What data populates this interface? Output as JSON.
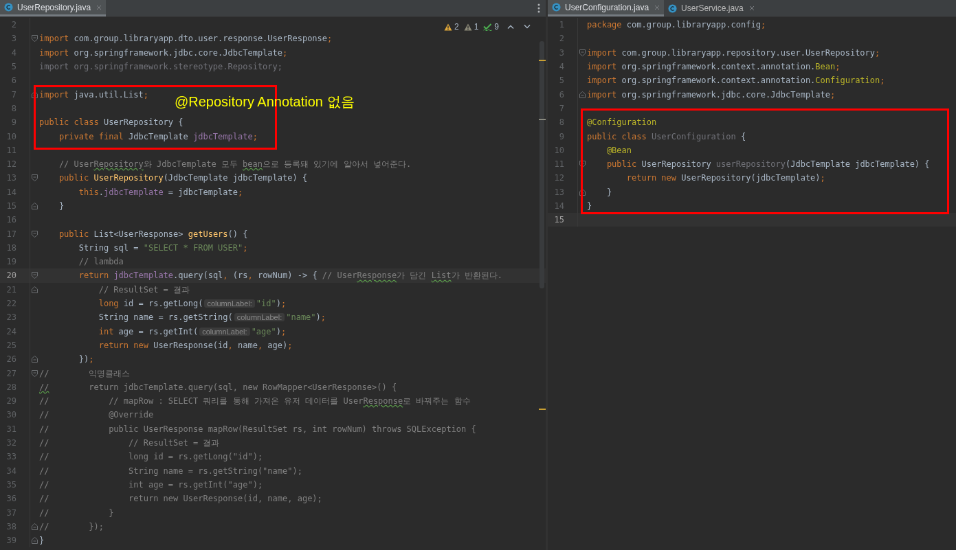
{
  "panes": [
    {
      "tabs": [
        {
          "label": "UserRepository.java",
          "selected": true
        }
      ],
      "inspections": [
        {
          "kind": "warning",
          "count": "2"
        },
        {
          "kind": "weak",
          "count": "1"
        },
        {
          "kind": "typo",
          "count": "9"
        }
      ],
      "note": "@Repository Annotation 없음",
      "lines": [
        {
          "number": "2"
        },
        {
          "number": "3",
          "fold_start": true,
          "tokens": [
            {
              "text": "import",
              "kind": "k"
            },
            {
              "text": " com.group.libraryapp.dto.user.response.UserResponse",
              "kind": "p"
            },
            {
              "text": ";",
              "kind": "k"
            }
          ]
        },
        {
          "number": "4",
          "tokens": [
            {
              "text": "import",
              "kind": "k"
            },
            {
              "text": " org.springframework.jdbc.core.JdbcTemplate",
              "kind": "p"
            },
            {
              "text": ";",
              "kind": "k"
            }
          ]
        },
        {
          "number": "5",
          "tokens": [
            {
              "text": "import org.springframework.stereotype.Repository;",
              "kind": "u"
            }
          ]
        },
        {
          "number": "6"
        },
        {
          "number": "7",
          "fold_end": true,
          "boxed": true,
          "tokens": [
            {
              "text": "import",
              "kind": "k"
            },
            {
              "text": " java.util.List",
              "kind": "p"
            },
            {
              "text": ";",
              "kind": "k"
            }
          ]
        },
        {
          "number": "8",
          "boxed": true
        },
        {
          "number": "9",
          "boxed": true,
          "tokens": [
            {
              "text": "public class ",
              "kind": "k"
            },
            {
              "text": "UserRepository {",
              "kind": "p"
            }
          ]
        },
        {
          "number": "10",
          "boxed": true,
          "tokens": [
            {
              "text": "    private final ",
              "kind": "k"
            },
            {
              "text": "JdbcTemplate ",
              "kind": "p"
            },
            {
              "text": "jdbcTemplate",
              "kind": "f"
            },
            {
              "text": ";",
              "kind": "k"
            }
          ]
        },
        {
          "number": "11"
        },
        {
          "number": "12",
          "tokens": [
            {
              "text": "    // User",
              "kind": "c"
            },
            {
              "text": "Repository",
              "kind": "ct"
            },
            {
              "text": "와 JdbcTemplate 모두 ",
              "kind": "c"
            },
            {
              "text": "bean",
              "kind": "ct"
            },
            {
              "text": "으로 등록돼 있기에 알아서 넣어준다.",
              "kind": "c"
            }
          ]
        },
        {
          "number": "13",
          "fold_start": true,
          "tokens": [
            {
              "text": "    public ",
              "kind": "k"
            },
            {
              "text": "UserRepository",
              "kind": "m"
            },
            {
              "text": "(JdbcTemplate jdbcTemplate) {",
              "kind": "p"
            }
          ]
        },
        {
          "number": "14",
          "tokens": [
            {
              "text": "        this",
              "kind": "k"
            },
            {
              "text": ".",
              "kind": "p"
            },
            {
              "text": "jdbcTemplate",
              "kind": "f"
            },
            {
              "text": " = jdbcTemplate",
              "kind": "p"
            },
            {
              "text": ";",
              "kind": "k"
            }
          ]
        },
        {
          "number": "15",
          "fold_end": true,
          "tokens": [
            {
              "text": "    }",
              "kind": "p"
            }
          ]
        },
        {
          "number": "16"
        },
        {
          "number": "17",
          "fold_start": true,
          "tokens": [
            {
              "text": "    public ",
              "kind": "k"
            },
            {
              "text": "List<UserResponse> ",
              "kind": "p"
            },
            {
              "text": "getUsers",
              "kind": "m"
            },
            {
              "text": "() {",
              "kind": "p"
            }
          ]
        },
        {
          "number": "18",
          "tokens": [
            {
              "text": "        String sql = ",
              "kind": "p"
            },
            {
              "text": "\"SELECT * FROM USER\"",
              "kind": "s"
            },
            {
              "text": ";",
              "kind": "k"
            }
          ]
        },
        {
          "number": "19",
          "tokens": [
            {
              "text": "        // lambda",
              "kind": "c"
            }
          ]
        },
        {
          "number": "20",
          "fold_start": true,
          "current": true,
          "tokens": [
            {
              "text": "        return ",
              "kind": "k"
            },
            {
              "text": "jdbcTemplate",
              "kind": "f"
            },
            {
              "text": ".query(sql",
              "kind": "p"
            },
            {
              "text": ", ",
              "kind": "k"
            },
            {
              "text": "(rs",
              "kind": "p"
            },
            {
              "text": ", ",
              "kind": "k"
            },
            {
              "text": "rowNum) -> { ",
              "kind": "p"
            },
            {
              "text": "// User",
              "kind": "c"
            },
            {
              "text": "Response",
              "kind": "ct"
            },
            {
              "text": "가 담긴 ",
              "kind": "c"
            },
            {
              "text": "List",
              "kind": "ct"
            },
            {
              "text": "가 반환된다.",
              "kind": "c"
            }
          ]
        },
        {
          "number": "21",
          "fold_end": true,
          "tokens": [
            {
              "text": "            // ResultSet = 결과",
              "kind": "c"
            }
          ]
        },
        {
          "number": "22",
          "tokens": [
            {
              "text": "            long ",
              "kind": "k"
            },
            {
              "text": "id = rs.getLong(",
              "kind": "p"
            },
            {
              "text": "columnLabel:",
              "kind": "h"
            },
            {
              "text": "\"id\"",
              "kind": "s"
            },
            {
              "text": ")",
              "kind": "p"
            },
            {
              "text": ";",
              "kind": "k"
            }
          ]
        },
        {
          "number": "23",
          "tokens": [
            {
              "text": "            String name = rs.getString(",
              "kind": "p"
            },
            {
              "text": "columnLabel:",
              "kind": "h"
            },
            {
              "text": "\"name\"",
              "kind": "s"
            },
            {
              "text": ")",
              "kind": "p"
            },
            {
              "text": ";",
              "kind": "k"
            }
          ]
        },
        {
          "number": "24",
          "tokens": [
            {
              "text": "            int ",
              "kind": "k"
            },
            {
              "text": "age = rs.getInt(",
              "kind": "p"
            },
            {
              "text": "columnLabel:",
              "kind": "h"
            },
            {
              "text": "\"age\"",
              "kind": "s"
            },
            {
              "text": ")",
              "kind": "p"
            },
            {
              "text": ";",
              "kind": "k"
            }
          ]
        },
        {
          "number": "25",
          "tokens": [
            {
              "text": "            return new ",
              "kind": "k"
            },
            {
              "text": "UserResponse(id",
              "kind": "p"
            },
            {
              "text": ", ",
              "kind": "k"
            },
            {
              "text": "name",
              "kind": "p"
            },
            {
              "text": ", ",
              "kind": "k"
            },
            {
              "text": "age)",
              "kind": "p"
            },
            {
              "text": ";",
              "kind": "k"
            }
          ]
        },
        {
          "number": "26",
          "fold_end": true,
          "tokens": [
            {
              "text": "        })",
              "kind": "p"
            },
            {
              "text": ";",
              "kind": "k"
            }
          ]
        },
        {
          "number": "27",
          "fold_start": true,
          "tokens": [
            {
              "text": "//        익명클래스",
              "kind": "c"
            }
          ]
        },
        {
          "number": "28",
          "tokens": [
            {
              "text": "//",
              "kind": "ct"
            },
            {
              "text": "        return jdbcTemplate.query(sql, new RowMapper<UserResponse>() {",
              "kind": "c"
            }
          ]
        },
        {
          "number": "29",
          "tokens": [
            {
              "text": "//            // mapRow : SELECT 쿼리를 통해 가져온 유저 데이터를 User",
              "kind": "c"
            },
            {
              "text": "Response",
              "kind": "ct"
            },
            {
              "text": "로 바꿔주는 함수",
              "kind": "c"
            }
          ]
        },
        {
          "number": "30",
          "tokens": [
            {
              "text": "//            @Override",
              "kind": "c"
            }
          ]
        },
        {
          "number": "31",
          "tokens": [
            {
              "text": "//            public UserResponse mapRow(ResultSet rs, int rowNum) throws SQLException {",
              "kind": "c"
            }
          ]
        },
        {
          "number": "32",
          "tokens": [
            {
              "text": "//                // ResultSet = 결과",
              "kind": "c"
            }
          ]
        },
        {
          "number": "33",
          "tokens": [
            {
              "text": "//                long id = rs.getLong(\"id\");",
              "kind": "c"
            }
          ]
        },
        {
          "number": "34",
          "tokens": [
            {
              "text": "//                String name = rs.getString(\"name\");",
              "kind": "c"
            }
          ]
        },
        {
          "number": "35",
          "tokens": [
            {
              "text": "//                int age = rs.getInt(\"age\");",
              "kind": "c"
            }
          ]
        },
        {
          "number": "36",
          "tokens": [
            {
              "text": "//                return new UserResponse(id, name, age);",
              "kind": "c"
            }
          ]
        },
        {
          "number": "37",
          "tokens": [
            {
              "text": "//            }",
              "kind": "c"
            }
          ]
        },
        {
          "number": "38",
          "fold_end": true,
          "tokens": [
            {
              "text": "//        });",
              "kind": "c"
            }
          ]
        },
        {
          "number": "39",
          "fold_end": true,
          "tokens": [
            {
              "text": "}",
              "kind": "p"
            }
          ]
        }
      ]
    },
    {
      "tabs": [
        {
          "label": "UserConfiguration.java",
          "selected": true
        },
        {
          "label": "UserService.java",
          "selected": false
        }
      ],
      "lines": [
        {
          "number": "1",
          "tokens": [
            {
              "text": "package ",
              "kind": "k"
            },
            {
              "text": "com.group.libraryapp.config",
              "kind": "p"
            },
            {
              "text": ";",
              "kind": "k"
            }
          ]
        },
        {
          "number": "2"
        },
        {
          "number": "3",
          "fold_start": true,
          "tokens": [
            {
              "text": "import ",
              "kind": "k"
            },
            {
              "text": "com.group.libraryapp.repository.user.UserRepository",
              "kind": "p"
            },
            {
              "text": ";",
              "kind": "k"
            }
          ]
        },
        {
          "number": "4",
          "tokens": [
            {
              "text": "import ",
              "kind": "k"
            },
            {
              "text": "org.springframework.context.annotation.",
              "kind": "p"
            },
            {
              "text": "Bean",
              "kind": "a"
            },
            {
              "text": ";",
              "kind": "k"
            }
          ]
        },
        {
          "number": "5",
          "tokens": [
            {
              "text": "import ",
              "kind": "k"
            },
            {
              "text": "org.springframework.context.annotation.",
              "kind": "p"
            },
            {
              "text": "Configuration",
              "kind": "a"
            },
            {
              "text": ";",
              "kind": "k"
            }
          ]
        },
        {
          "number": "6",
          "fold_end": true,
          "tokens": [
            {
              "text": "import ",
              "kind": "k"
            },
            {
              "text": "org.springframework.jdbc.core.JdbcTemplate",
              "kind": "p"
            },
            {
              "text": ";",
              "kind": "k"
            }
          ]
        },
        {
          "number": "7"
        },
        {
          "number": "8",
          "boxed": true,
          "tokens": [
            {
              "text": "@Configuration",
              "kind": "a"
            }
          ]
        },
        {
          "number": "9",
          "boxed": true,
          "tokens": [
            {
              "text": "public class ",
              "kind": "k"
            },
            {
              "text": "UserConfiguration",
              "kind": "u"
            },
            {
              "text": " {",
              "kind": "p"
            }
          ]
        },
        {
          "number": "10",
          "boxed": true,
          "tokens": [
            {
              "text": "    @Bean",
              "kind": "a"
            }
          ]
        },
        {
          "number": "11",
          "boxed": true,
          "fold_start": true,
          "tokens": [
            {
              "text": "    public ",
              "kind": "k"
            },
            {
              "text": "UserRepository ",
              "kind": "p"
            },
            {
              "text": "userRepository",
              "kind": "u"
            },
            {
              "text": "(JdbcTemplate jdbcTemplate) {",
              "kind": "p"
            }
          ]
        },
        {
          "number": "12",
          "boxed": true,
          "tokens": [
            {
              "text": "        return new ",
              "kind": "k"
            },
            {
              "text": "UserRepository(jdbcTemplate)",
              "kind": "p"
            },
            {
              "text": ";",
              "kind": "k"
            }
          ]
        },
        {
          "number": "13",
          "boxed": true,
          "fold_end": true,
          "tokens": [
            {
              "text": "    }",
              "kind": "p"
            }
          ]
        },
        {
          "number": "14",
          "boxed": true,
          "tokens": [
            {
              "text": "}",
              "kind": "p"
            }
          ]
        },
        {
          "number": "15",
          "current": true
        }
      ]
    }
  ]
}
